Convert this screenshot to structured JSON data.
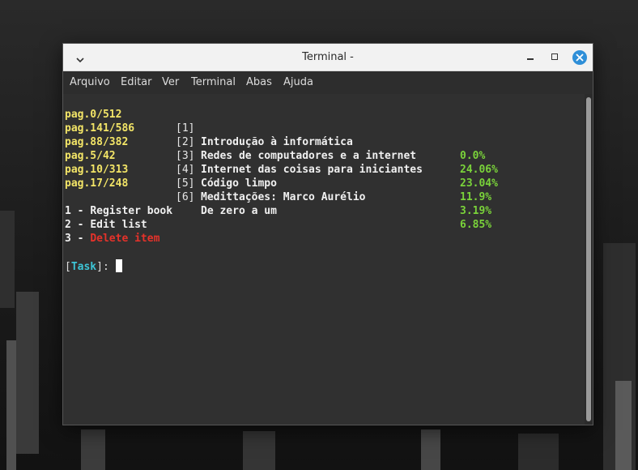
{
  "window": {
    "title": "Terminal -",
    "menu": [
      "Arquivo",
      "Editar",
      "Ver",
      "Terminal",
      "Abas",
      "Ajuda"
    ]
  },
  "books": [
    {
      "page": "pag.0/512",
      "index": "[1]",
      "title": "Introdução à informática",
      "percent": "0.0%"
    },
    {
      "page": "pag.141/586",
      "index": "[2]",
      "title": "Redes de computadores e a internet",
      "percent": "24.06%"
    },
    {
      "page": "pag.88/382",
      "index": "[3]",
      "title": "Internet das coisas para iniciantes",
      "percent": "23.04%"
    },
    {
      "page": "pag.5/42",
      "index": "[4]",
      "title": "Código limpo",
      "percent": "11.9%"
    },
    {
      "page": "pag.10/313",
      "index": "[5]",
      "title": "Medittações: Marco Aurélio",
      "percent": "3.19%"
    },
    {
      "page": "pag.17/248",
      "index": "[6]",
      "title": "De zero a um",
      "percent": "6.85%"
    }
  ],
  "options": [
    {
      "prefix": "1 - ",
      "label": "Register book"
    },
    {
      "prefix": "2 - ",
      "label": "Edit list"
    },
    {
      "prefix": "3 - ",
      "label": "Delete item"
    }
  ],
  "prompt": {
    "open": "[",
    "label": "Task",
    "close": "]: "
  },
  "colors": {
    "page": "#f3e567",
    "percent": "#7ad33a",
    "delete": "#e5322a",
    "task": "#3dc5d6",
    "close_button": "#2f8fd8"
  },
  "icons": {
    "window_menu": "chevron-down-icon",
    "minimize": "minimize-icon",
    "maximize": "maximize-icon",
    "close": "close-icon"
  }
}
